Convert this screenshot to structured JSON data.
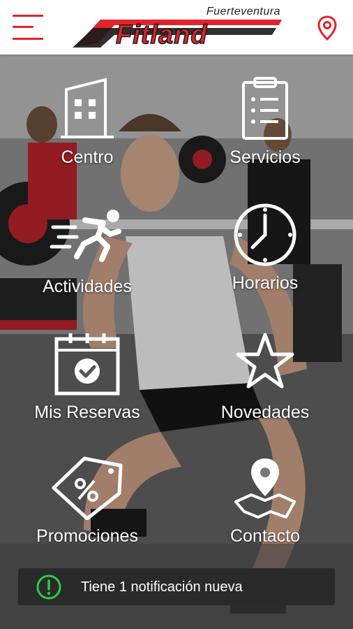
{
  "header": {
    "logo_text": "Fitland",
    "logo_subtitle": "Fuerteventura",
    "menu_icon": "hamburger-icon",
    "location_icon": "map-pin-icon",
    "accent_color": "#e1242b"
  },
  "menu": {
    "items": [
      {
        "label": "Centro",
        "icon": "building-icon"
      },
      {
        "label": "Servicios",
        "icon": "clipboard-list-icon"
      },
      {
        "label": "Actividades",
        "icon": "running-man-icon"
      },
      {
        "label": "Horarios",
        "icon": "clock-icon"
      },
      {
        "label": "Mis Reservas",
        "icon": "calendar-check-icon"
      },
      {
        "label": "Novedades",
        "icon": "star-icon"
      },
      {
        "label": "Promociones",
        "icon": "percent-tag-icon"
      },
      {
        "label": "Contacto",
        "icon": "map-location-icon"
      }
    ]
  },
  "notification": {
    "text": "Tiene 1 notificación nueva",
    "icon": "alert-circle-icon",
    "icon_color": "#2ecc40"
  }
}
